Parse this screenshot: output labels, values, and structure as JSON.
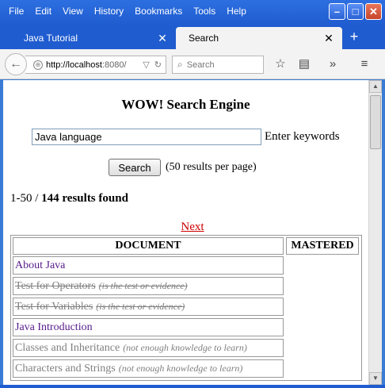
{
  "window": {
    "menu": [
      "File",
      "Edit",
      "View",
      "History",
      "Bookmarks",
      "Tools",
      "Help"
    ],
    "controls": {
      "minimize": "–",
      "maximize": "□",
      "close": "✕"
    }
  },
  "tabs": [
    {
      "label": "Java Tutorial",
      "close": "✕",
      "active": false
    },
    {
      "label": "Search",
      "close": "✕",
      "active": true
    }
  ],
  "newtab_label": "+",
  "navbar": {
    "url_scheme": "http://",
    "url_host": "localhost",
    "url_port": ":8080/",
    "search_placeholder": "Search"
  },
  "page": {
    "title": "WOW! Search Engine",
    "keyword_value": "Java language",
    "keyword_label": "Enter keywords",
    "search_button": "Search",
    "per_page_text": "(50 results per page)",
    "results_range": "1-50 / ",
    "results_count": "144 results found",
    "next_link": "Next",
    "table": {
      "col_document": "DOCUMENT",
      "col_mastered": "MASTERED",
      "rows": [
        {
          "title": "About Java",
          "note": "",
          "style": "link"
        },
        {
          "title": "Test for Operators",
          "note": "(is the test or evidence)",
          "style": "strike"
        },
        {
          "title": "Test for Variables",
          "note": "(is the test or evidence)",
          "style": "strike"
        },
        {
          "title": "Java Introduction",
          "note": "",
          "style": "link"
        },
        {
          "title": "Classes and Inheritance",
          "note": "(not enough knowledge to learn)",
          "style": "gray"
        },
        {
          "title": "Characters and Strings",
          "note": "(not enough knowledge to learn)",
          "style": "gray"
        }
      ]
    }
  },
  "colors": {
    "titlebar": "#1f5cd0",
    "link": "#551a8b",
    "next": "#cc0000",
    "disabled": "#808080"
  }
}
